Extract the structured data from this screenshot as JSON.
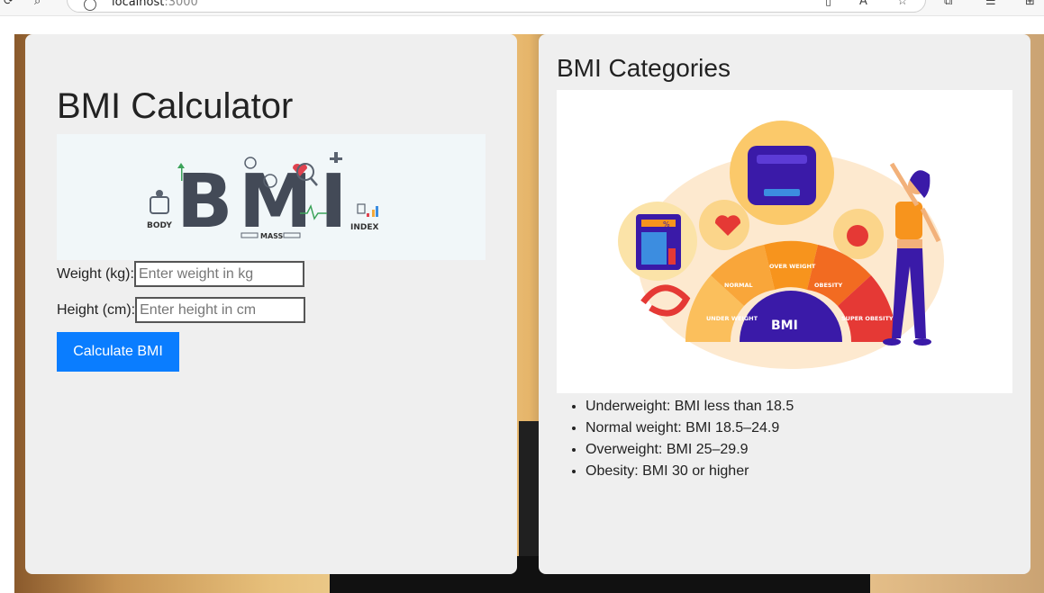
{
  "browser": {
    "url_host": "localhost",
    "url_port": ":3000"
  },
  "calculator": {
    "title": "BMI Calculator",
    "banner": {
      "letters": [
        "B",
        "M",
        "I"
      ],
      "captions": [
        "BODY",
        "MASS",
        "INDEX"
      ]
    },
    "weight_label": "Weight (kg):",
    "weight_placeholder": "Enter weight in kg",
    "weight_value": "",
    "height_label": "Height (cm):",
    "height_placeholder": "Enter height in cm",
    "height_value": "",
    "button_label": "Calculate BMI"
  },
  "categories": {
    "title": "BMI Categories",
    "gauge": {
      "center_label": "BMI",
      "segments": [
        "UNDER WEIGHT",
        "NORMAL",
        "OVER WEIGHT",
        "OBESITY",
        "SUPER OBESITY"
      ],
      "calculator_badge": "%"
    },
    "items": [
      "Underweight: BMI less than 18.5",
      "Normal weight: BMI 18.5–24.9",
      "Overweight: BMI 25–29.9",
      "Obesity: BMI 30 or higher"
    ]
  },
  "colors": {
    "button": "#0a7dff",
    "card": "#efefef",
    "gauge_orange": "#f7941d",
    "gauge_red": "#e53935",
    "gauge_purple": "#3a1aa8"
  }
}
